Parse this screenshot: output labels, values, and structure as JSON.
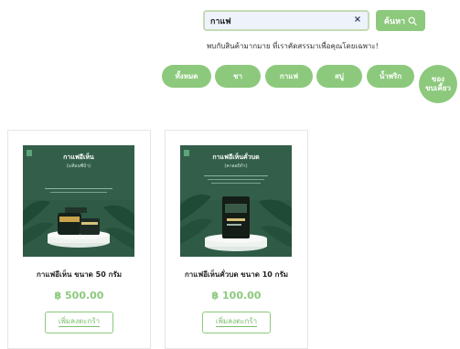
{
  "search": {
    "value": "กาแฟ",
    "clear_glyph": "×",
    "button_label": "ค้นหา",
    "button_icon": "search-icon"
  },
  "tagline": "พบกับสินค้ามากมาย ที่เราคัดสรรมาเพื่อคุณโดยเฉพาะ!",
  "categories": [
    {
      "label": "ทั้งหมด"
    },
    {
      "label": "ชา"
    },
    {
      "label": "กาแฟ"
    },
    {
      "label": "สบู่"
    },
    {
      "label": "น้ำพริก"
    },
    {
      "label": "ของ\nขบเคี้ยว"
    }
  ],
  "products": [
    {
      "name": "กาแฟอีเห็น ขนาด 50 กรัม",
      "price": "฿ 500.00",
      "button": "เพิ่มลงตะกร้า",
      "image_title": "กาแฟอีเห็น",
      "image_subtitle": "(แท้อนซีบ้า)"
    },
    {
      "name": "กาแฟอีเห็นคั่วบด ขนาด 10 กรัม",
      "price": "฿ 100.00",
      "button": "เพิ่มลงตะกร้า",
      "image_title": "กาแฟอีเห็นคั่วบด",
      "image_subtitle": "(คาลอบิก้า)"
    }
  ],
  "colors": {
    "accent": "#8cc97c",
    "image_background": "#2e5a46",
    "leaf": "#1f4a35"
  }
}
